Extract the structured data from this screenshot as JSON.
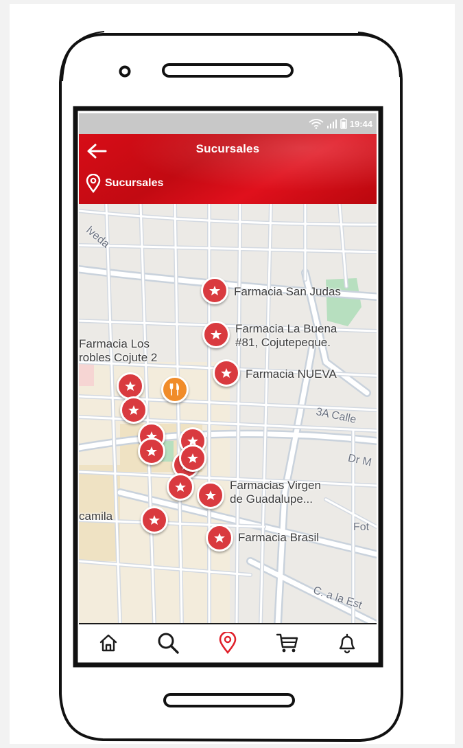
{
  "status_bar": {
    "time": "19:44"
  },
  "header": {
    "title": "Sucursales",
    "subtitle": "Sucursales"
  },
  "map": {
    "places": [
      {
        "id": "san-judas",
        "name": "Farmacia San Judas"
      },
      {
        "id": "la-buena",
        "name": "Farmacia La Buena\n#81, Cojutepeque."
      },
      {
        "id": "los-robles",
        "name": "Farmacia Los\nrobles Cojute 2"
      },
      {
        "id": "nueva",
        "name": "Farmacia NUEVA"
      },
      {
        "id": "virgen",
        "name": "Farmacias Virgen\nde Guadalupe..."
      },
      {
        "id": "brasil",
        "name": "Farmacia Brasil"
      },
      {
        "id": "camila",
        "name": "camila"
      }
    ],
    "streets": [
      {
        "id": "sepulveda",
        "name": "lveda"
      },
      {
        "id": "3a-calle",
        "name": "3A Calle"
      },
      {
        "id": "dr-m",
        "name": "Dr M"
      },
      {
        "id": "c-a-la-est",
        "name": "C. a la Est"
      },
      {
        "id": "fot",
        "name": "Fot"
      }
    ]
  },
  "bottom_nav": [
    {
      "id": "home",
      "icon": "home-icon",
      "active": false
    },
    {
      "id": "search",
      "icon": "search-icon",
      "active": false
    },
    {
      "id": "locations",
      "icon": "location-pin-icon",
      "active": true
    },
    {
      "id": "cart",
      "icon": "cart-icon",
      "active": false
    },
    {
      "id": "notifications",
      "icon": "bell-icon",
      "active": false
    }
  ],
  "colors": {
    "brand": "#d70d17",
    "pin": "#d93a3f",
    "restaurant_pin": "#f08c2a",
    "active_nav": "#e0202a"
  }
}
